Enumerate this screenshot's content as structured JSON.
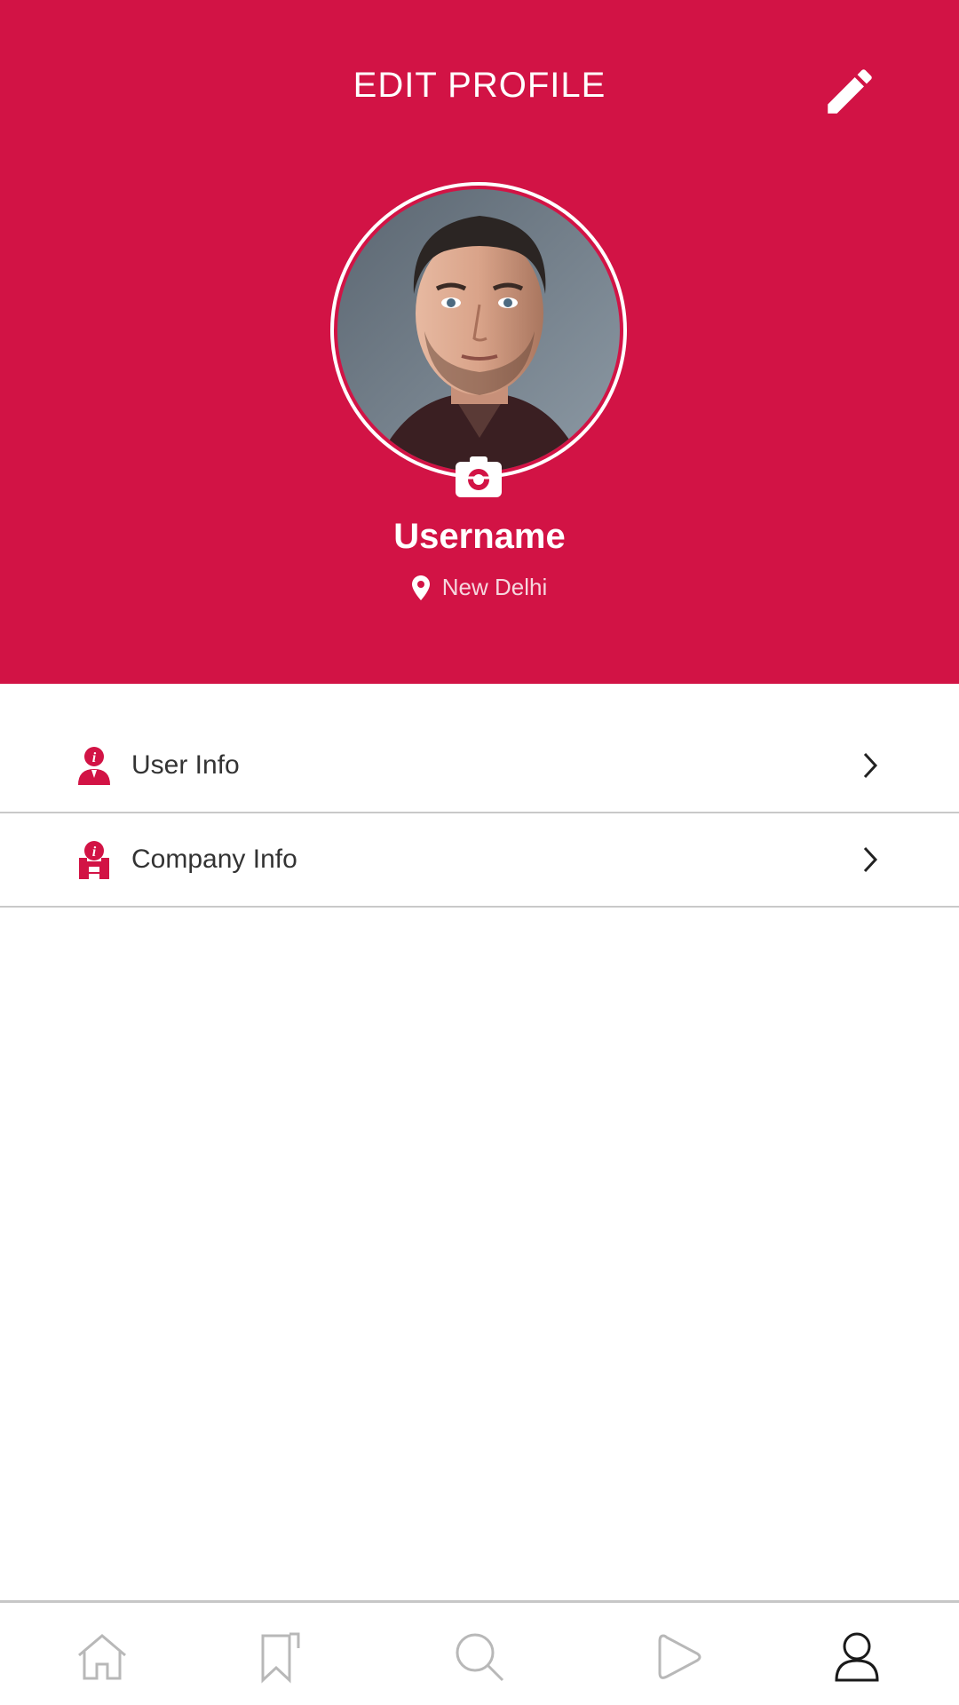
{
  "header": {
    "title": "EDIT PROFILE",
    "edit_icon": "pencil-icon",
    "camera_icon": "camera-icon"
  },
  "profile": {
    "username": "Username",
    "location": "New Delhi",
    "location_icon": "map-pin-icon"
  },
  "menu": {
    "items": [
      {
        "label": "User Info",
        "icon": "user-info-icon"
      },
      {
        "label": "Company Info",
        "icon": "company-info-icon"
      }
    ]
  },
  "nav": {
    "items": [
      "home-icon",
      "bookmark-icon",
      "search-icon",
      "play-icon",
      "profile-icon"
    ],
    "active": "profile-icon"
  },
  "colors": {
    "primary": "#d21345",
    "text": "#333333",
    "divider": "#c9c9c9",
    "nav_inactive": "#b8b8b8",
    "nav_active": "#1a1a1a"
  }
}
